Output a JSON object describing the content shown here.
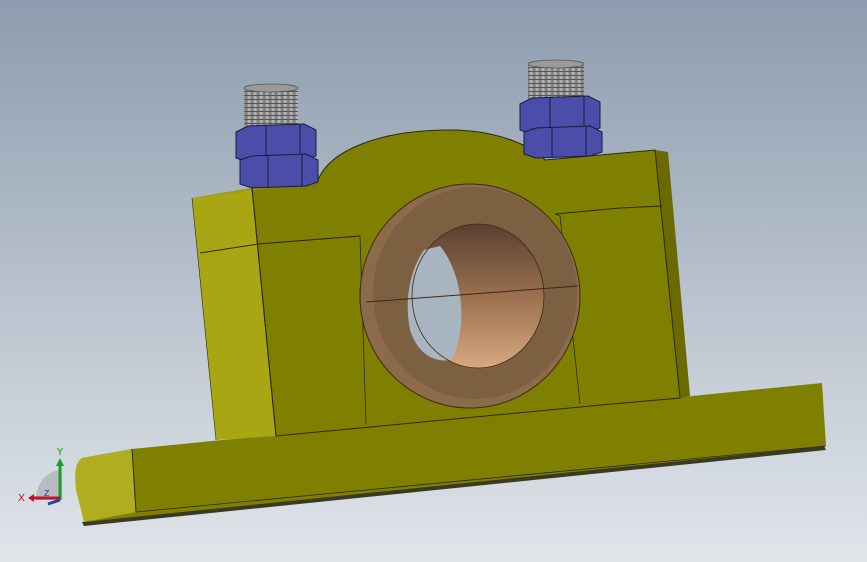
{
  "view": {
    "background_top": "#8d9cae",
    "background_bottom": "#e1e5ea"
  },
  "triad": {
    "x_label": "X",
    "y_label": "Y",
    "z_label": "Z",
    "x_color": "#c8102e",
    "y_color": "#1a9e2a",
    "z_color": "#2b3f9e"
  },
  "model": {
    "housing_color": "#808000",
    "housing_highlight": "#c9c432",
    "bushing_color": "#8b6b4a",
    "nut_color": "#4b4ea8",
    "thread_color": "#8a8a8a"
  }
}
